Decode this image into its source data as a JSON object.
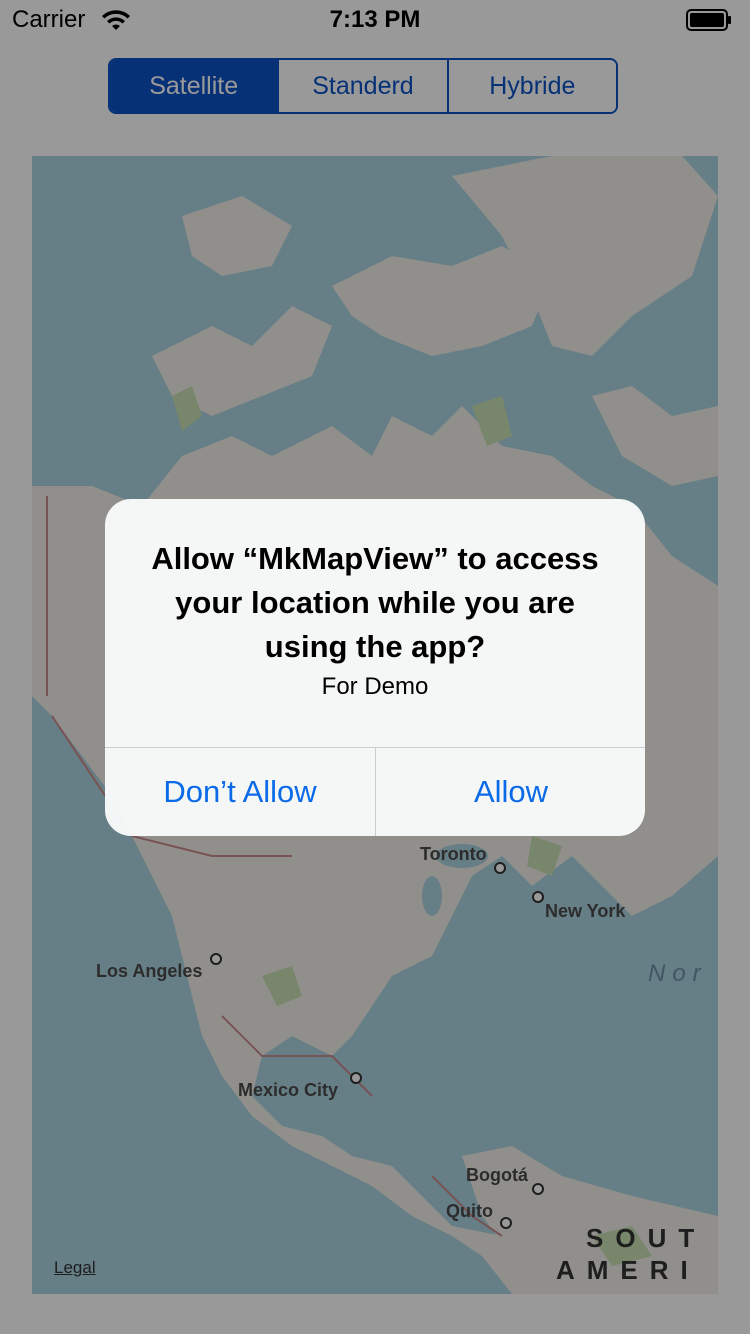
{
  "status_bar": {
    "carrier": "Carrier",
    "time": "7:13 PM",
    "wifi_icon": "wifi-icon",
    "battery_icon": "battery-icon"
  },
  "segmented_control": {
    "selected": "Satellite",
    "segments": [
      "Satellite",
      "Standerd",
      "Hybride"
    ],
    "accent_color": "#0a52c7"
  },
  "map": {
    "cities": [
      "Toronto",
      "New York",
      "Los Angeles",
      "Mexico City",
      "Bogotá",
      "Quito"
    ],
    "ocean_label": "Nor",
    "continent_label_line1": "SOUT",
    "continent_label_line2": "AMERI",
    "legal": "Legal"
  },
  "alert": {
    "title": "Allow “MkMapView” to access your location while you are using the app?",
    "message": "For Demo",
    "deny_button": "Don’t Allow",
    "allow_button": "Allow",
    "button_color": "#0a6ae8"
  }
}
